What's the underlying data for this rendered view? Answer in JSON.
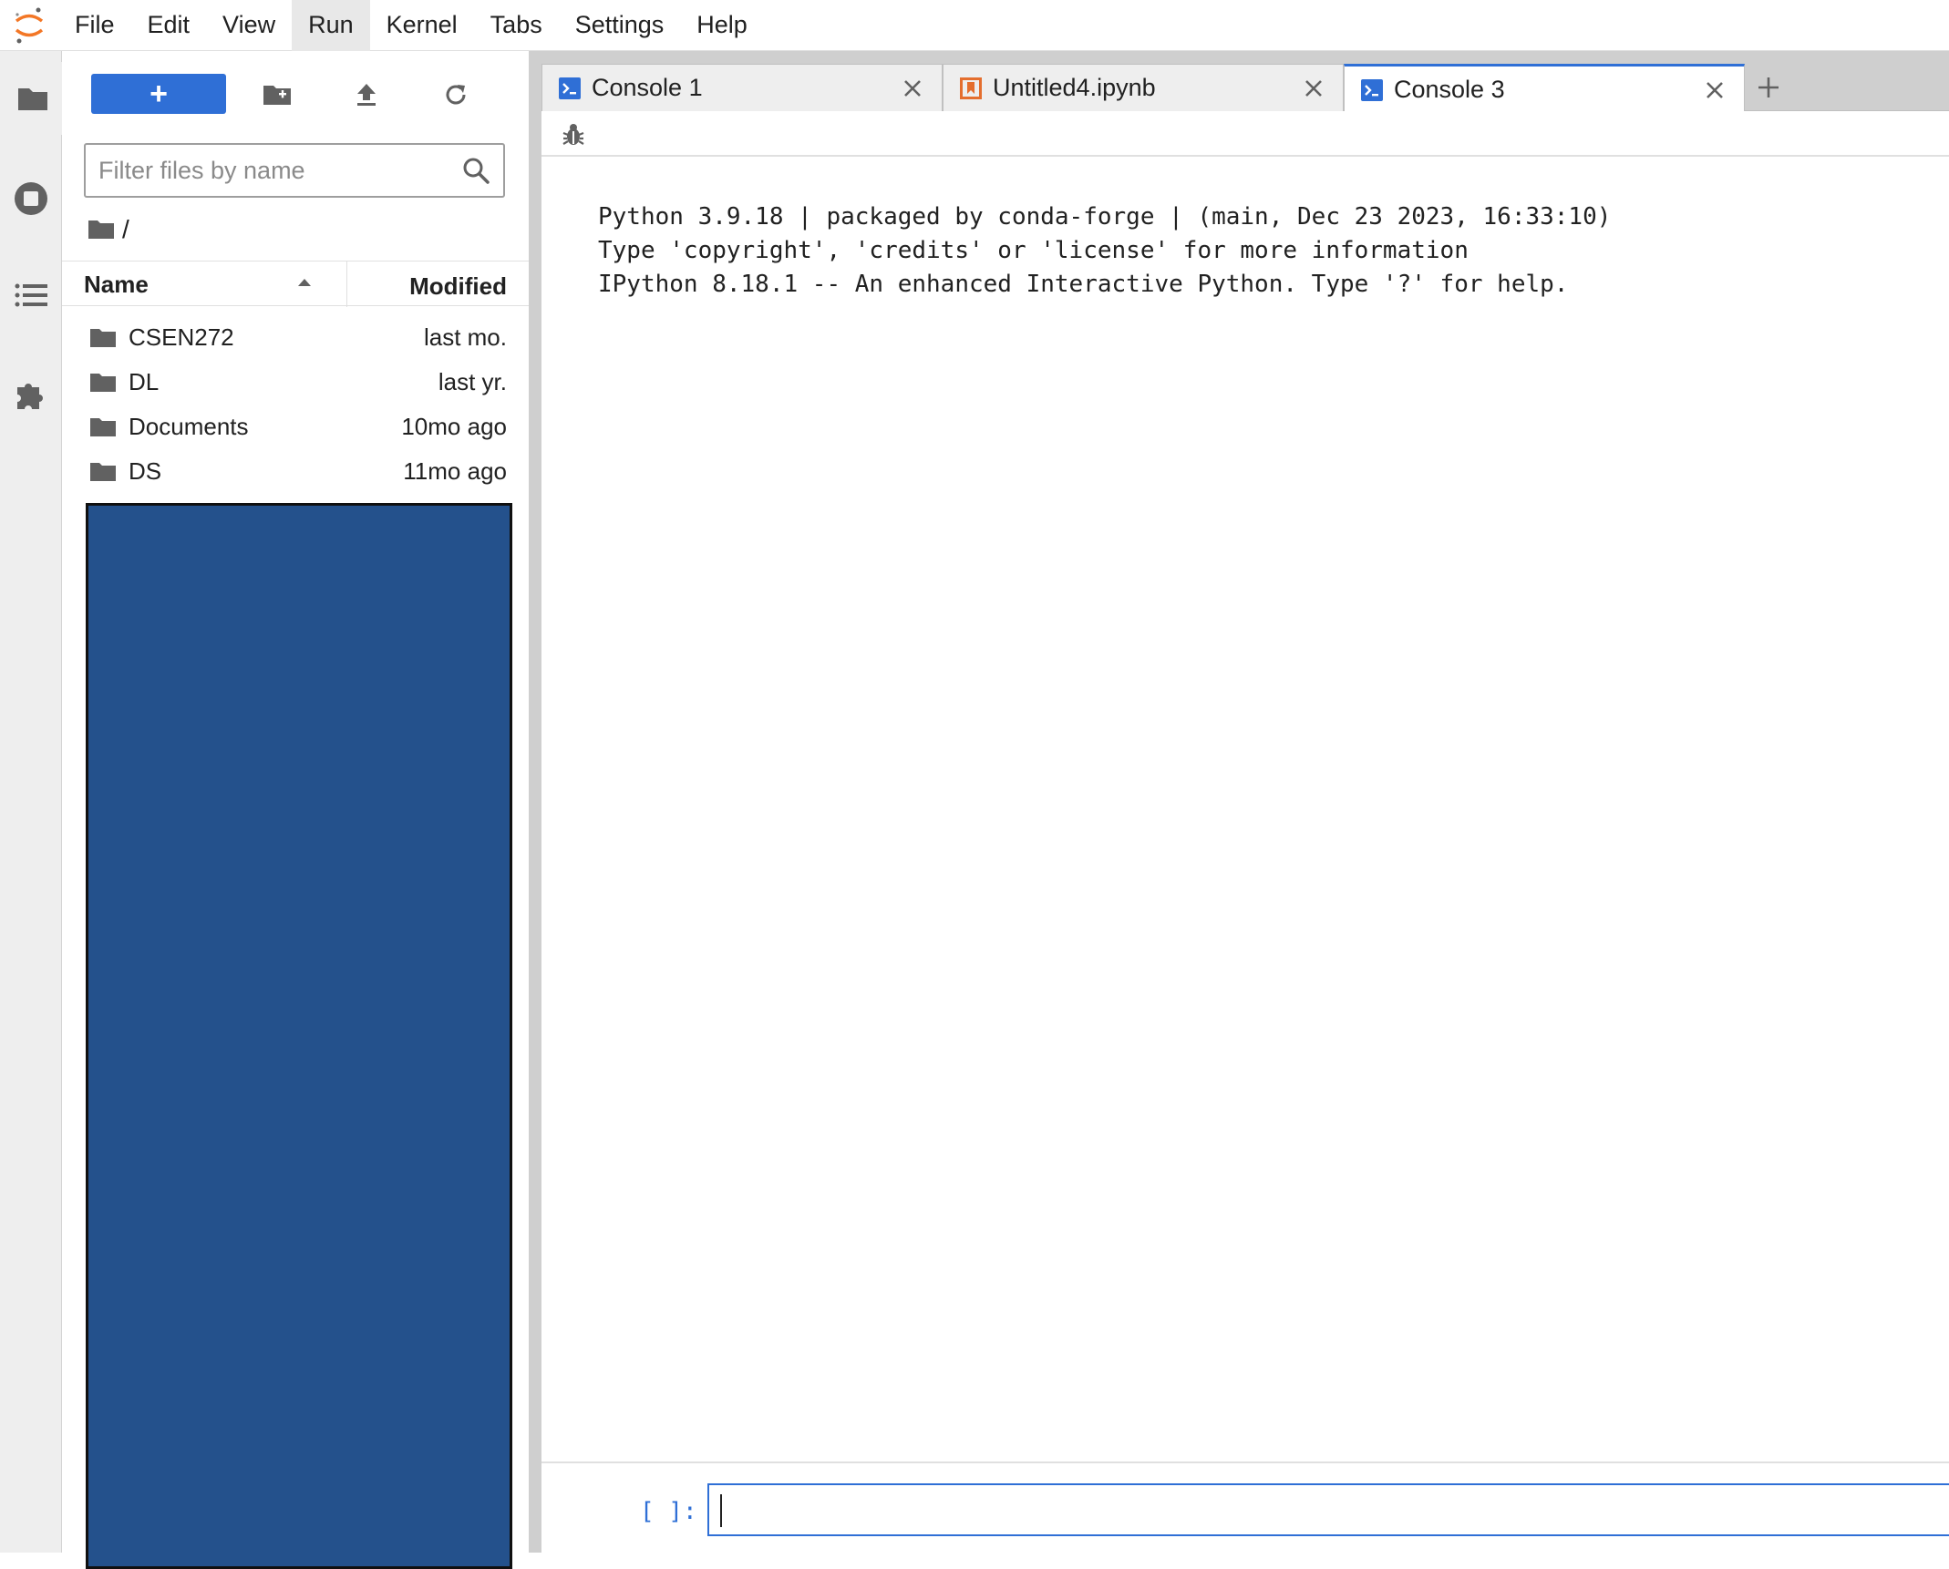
{
  "menubar": {
    "items": [
      "File",
      "Edit",
      "View",
      "Run",
      "Kernel",
      "Tabs",
      "Settings",
      "Help"
    ],
    "active": "Run"
  },
  "activity_bar": {
    "icons": [
      "folder-icon",
      "running-icon",
      "toc-icon",
      "extension-icon"
    ]
  },
  "filebrowser": {
    "new_label": "+",
    "filter_placeholder": "Filter files by name",
    "breadcrumb": "/",
    "columns": {
      "name": "Name",
      "modified": "Modified"
    },
    "files": [
      {
        "name": "CSEN272",
        "modified": "last mo."
      },
      {
        "name": "DL",
        "modified": "last yr."
      },
      {
        "name": "Documents",
        "modified": "10mo ago"
      },
      {
        "name": "DS",
        "modified": "11mo ago"
      }
    ]
  },
  "tabs": [
    {
      "label": "Console 1",
      "icon": "console-icon",
      "active": false
    },
    {
      "label": "Untitled4.ipynb",
      "icon": "notebook-icon",
      "active": false
    },
    {
      "label": "Console 3",
      "icon": "console-icon",
      "active": true
    }
  ],
  "console": {
    "output": [
      "Python 3.9.18 | packaged by conda-forge | (main, Dec 23 2023, 16:33:10)",
      "Type 'copyright', 'credits' or 'license' for more information",
      "IPython 8.18.1 -- An enhanced Interactive Python. Type '?' for help."
    ],
    "prompt": "[ ]:",
    "input_value": ""
  },
  "colors": {
    "accent": "#2f6fd6",
    "notebook_orange": "#e46e2e",
    "logo_orange": "#f37726",
    "redaction": "#24518c"
  }
}
